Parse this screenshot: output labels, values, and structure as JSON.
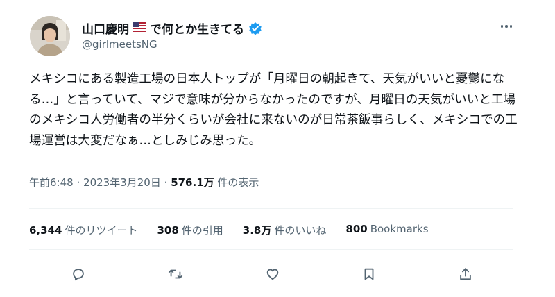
{
  "author": {
    "display_name": "山口慶明",
    "display_name_suffix": "で何とか生きてる",
    "handle": "@girlmeetsNG",
    "flag_icon": "us-flag-icon",
    "verified_icon": "verified-badge-icon",
    "verified_color": "#1d9bf0"
  },
  "tweet": {
    "text": "メキシコにある製造工場の日本人トップが「月曜日の朝起きて、天気がいいと憂鬱になる…」と言っていて、マジで意味が分からなかったのですが、月曜日の天気がいいと工場のメキシコ人労働者の半分くらいが会社に来ないのが日常茶飯事らしく、メキシコでの工場運営は大変だなぁ…としみじみ思った。",
    "time": "午前6:48",
    "separator": "·",
    "date": "2023年3月20日",
    "views_count": "576.1万",
    "views_label": "件の表示"
  },
  "stats": {
    "retweets_count": "6,344",
    "retweets_label": "件のリツイート",
    "quotes_count": "308",
    "quotes_label": "件の引用",
    "likes_count": "3.8万",
    "likes_label": "件のいいね",
    "bookmarks_count": "800",
    "bookmarks_label": "Bookmarks"
  },
  "actions": [
    "reply-icon",
    "retweet-icon",
    "like-icon",
    "bookmark-icon",
    "share-icon"
  ]
}
